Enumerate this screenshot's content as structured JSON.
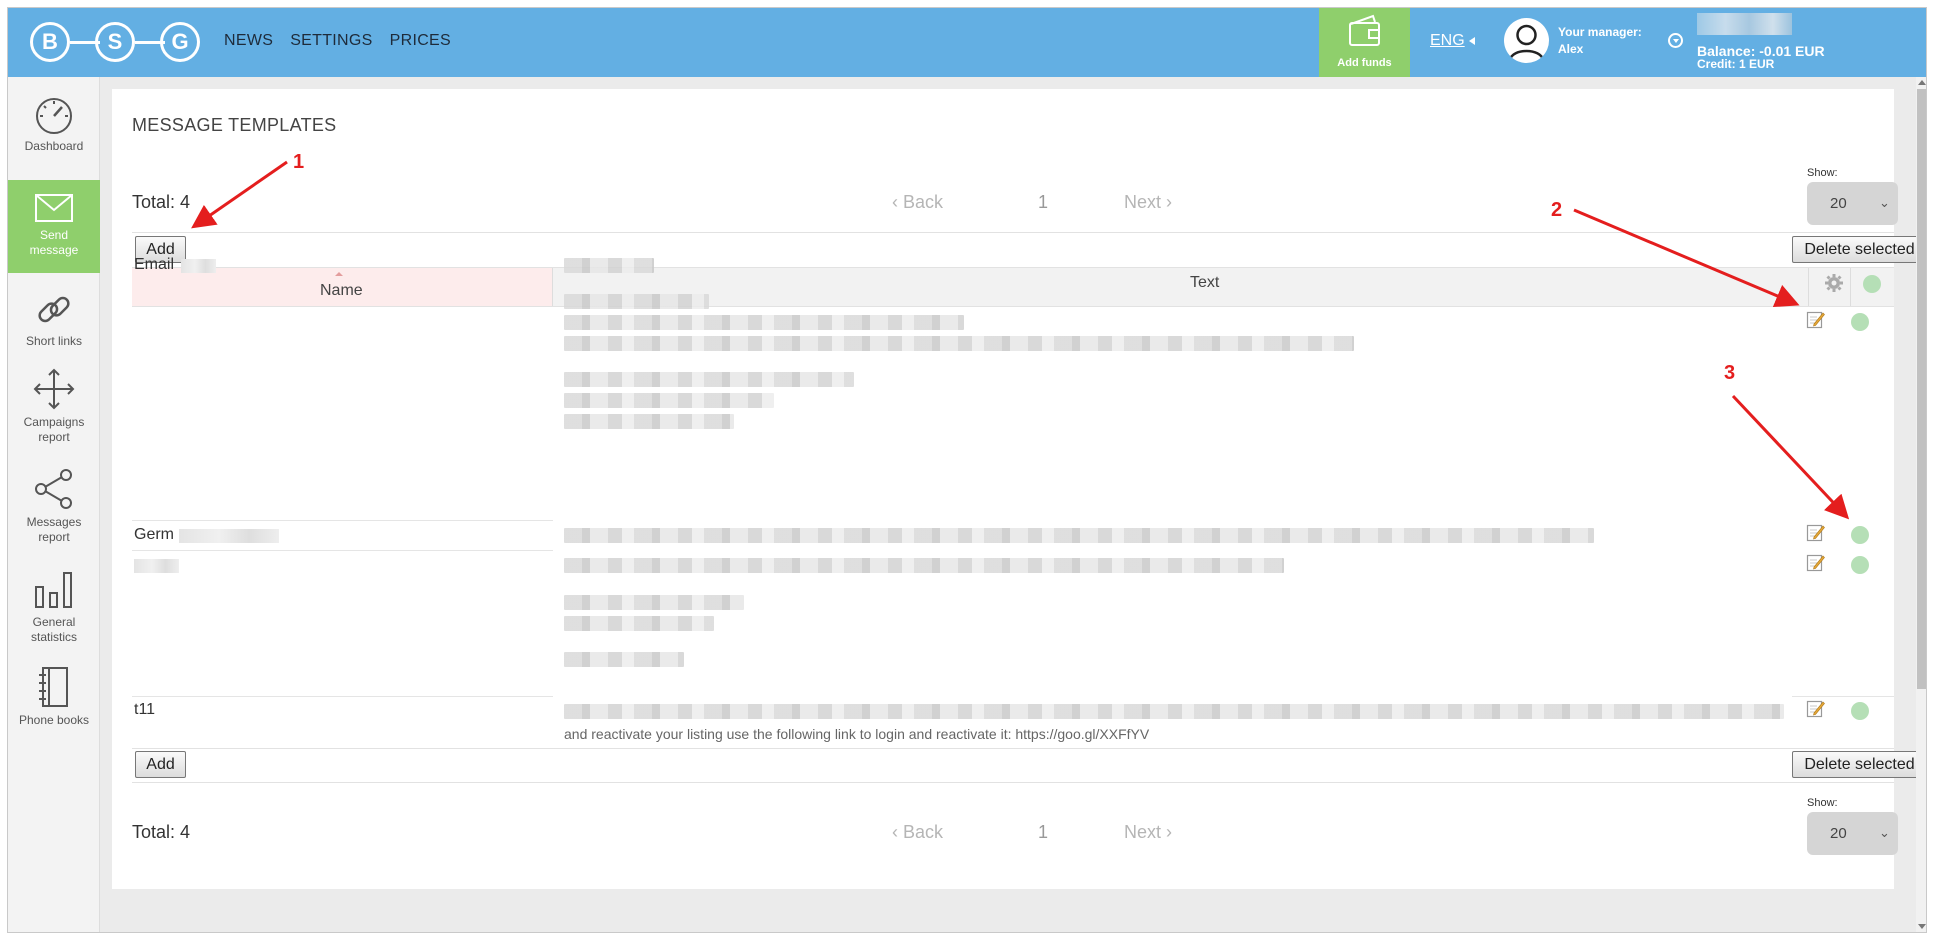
{
  "header": {
    "logo_letters": [
      "B",
      "S",
      "G"
    ],
    "nav": [
      "NEWS",
      "SETTINGS",
      "PRICES"
    ],
    "add_funds": "Add funds",
    "language": "ENG",
    "manager_label": "Your manager:",
    "manager_name": "Alex",
    "balance": "Balance: -0.01 EUR",
    "credit": "Credit: 1 EUR"
  },
  "sidebar": {
    "items": [
      {
        "label": "Dashboard",
        "icon": "speedometer-icon"
      },
      {
        "label": "Send message",
        "icon": "envelope-icon"
      },
      {
        "label": "Short links",
        "icon": "link-icon"
      },
      {
        "label": "Campaigns report",
        "icon": "move-arrows-icon"
      },
      {
        "label": "Messages report",
        "icon": "share-icon"
      },
      {
        "label": "General statistics",
        "icon": "bar-chart-icon"
      },
      {
        "label": "Phone books",
        "icon": "notebook-icon"
      }
    ]
  },
  "main": {
    "title": "MESSAGE TEMPLATES",
    "total": "Total: 4",
    "pager": {
      "back": "Back",
      "page": "1",
      "next": "Next"
    },
    "show_label": "Show:",
    "show_value": "20",
    "add_label": "Add",
    "delete_selected_label": "Delete selected",
    "columns": {
      "name": "Name",
      "text": "Text"
    },
    "rows": [
      {
        "name": "Email"
      },
      {
        "name": "Germ"
      },
      {
        "name": ""
      },
      {
        "name": "t11",
        "text_visible": "and reactivate your listing use the following link to login and reactivate it: https://goo.gl/XXFfYV"
      }
    ]
  },
  "annotations": [
    "1",
    "2",
    "3"
  ],
  "colors": {
    "header": "#63afe3",
    "accent_green": "#8fcf6c",
    "annotation_red": "#e41e1e",
    "status_dot": "#b5dfb6"
  }
}
